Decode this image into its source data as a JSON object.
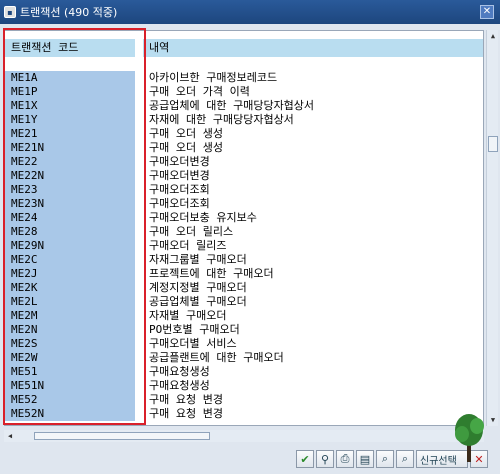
{
  "window": {
    "title": "트랜잭션 (490 적중)",
    "close_symbol": "✕"
  },
  "table": {
    "header_code": "트랜잭션 코드",
    "header_desc": "내역",
    "rows": [
      {
        "code": "ME1A",
        "desc": "아카이브한 구매정보레코드"
      },
      {
        "code": "ME1P",
        "desc": "구매 오더 가격 이력"
      },
      {
        "code": "ME1X",
        "desc": "공급업체에 대한 구매당당자협상서"
      },
      {
        "code": "ME1Y",
        "desc": "자재에 대한 구매당당자협상서"
      },
      {
        "code": "ME21",
        "desc": "구매 오더 생성"
      },
      {
        "code": "ME21N",
        "desc": "구매 오더 생성"
      },
      {
        "code": "ME22",
        "desc": "구매오더변경"
      },
      {
        "code": "ME22N",
        "desc": "구매오더변경"
      },
      {
        "code": "ME23",
        "desc": "구매오더조회"
      },
      {
        "code": "ME23N",
        "desc": "구매오더조회"
      },
      {
        "code": "ME24",
        "desc": "구매오더보충 유지보수"
      },
      {
        "code": "ME28",
        "desc": "구매 오더 릴리스"
      },
      {
        "code": "ME29N",
        "desc": "구매오더 릴리즈"
      },
      {
        "code": "ME2C",
        "desc": "자재그룹별 구매오더"
      },
      {
        "code": "ME2J",
        "desc": "프로젝트에 대한 구매오더"
      },
      {
        "code": "ME2K",
        "desc": "계정지정별 구매오더"
      },
      {
        "code": "ME2L",
        "desc": "공급업체별 구매오더"
      },
      {
        "code": "ME2M",
        "desc": "자재별 구매오더"
      },
      {
        "code": "ME2N",
        "desc": "PO번호별 구매오더"
      },
      {
        "code": "ME2S",
        "desc": "구매오더별 서비스"
      },
      {
        "code": "ME2W",
        "desc": "공급플랜트에 대한 구매오더"
      },
      {
        "code": "ME51",
        "desc": "구매요청생성"
      },
      {
        "code": "ME51N",
        "desc": "구매요청생성"
      },
      {
        "code": "ME52",
        "desc": "구매 요청 변경"
      },
      {
        "code": "ME52N",
        "desc": "구매 요청 변경"
      }
    ]
  },
  "toolbar": {
    "new_selection_label": "신규선택",
    "icons": [
      "check-icon",
      "filter-icon",
      "print-icon",
      "save-icon",
      "find-icon",
      "find-next-icon",
      "close-icon"
    ]
  },
  "colors": {
    "title_bar": "#1d467e",
    "header_bg": "#b9ddf0",
    "code_bg": "#a9c8e8",
    "highlight_border": "#d9202a"
  }
}
